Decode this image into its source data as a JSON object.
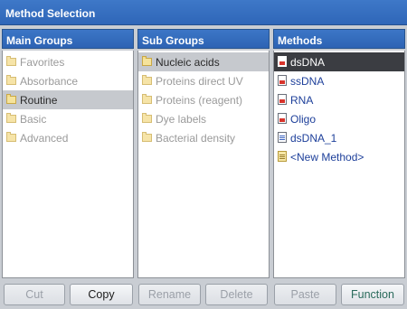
{
  "window": {
    "title": "Method Selection"
  },
  "main_groups": {
    "header": "Main Groups",
    "items": [
      {
        "label": "Favorites",
        "state": "disabled",
        "icon": "folder-icon"
      },
      {
        "label": "Absorbance",
        "state": "disabled",
        "icon": "folder-icon"
      },
      {
        "label": "Routine",
        "state": "selected",
        "icon": "folder-open-icon"
      },
      {
        "label": "Basic",
        "state": "disabled",
        "icon": "folder-icon"
      },
      {
        "label": "Advanced",
        "state": "disabled",
        "icon": "folder-icon"
      }
    ]
  },
  "sub_groups": {
    "header": "Sub Groups",
    "items": [
      {
        "label": "Nucleic acids",
        "state": "selected",
        "icon": "folder-open-icon"
      },
      {
        "label": "Proteins direct UV",
        "state": "disabled",
        "icon": "folder-icon"
      },
      {
        "label": "Proteins (reagent)",
        "state": "disabled",
        "icon": "folder-icon"
      },
      {
        "label": "Dye labels",
        "state": "disabled",
        "icon": "folder-icon"
      },
      {
        "label": "Bacterial density",
        "state": "disabled",
        "icon": "folder-icon"
      }
    ]
  },
  "methods": {
    "header": "Methods",
    "items": [
      {
        "label": "dsDNA",
        "state": "selected",
        "icon": "locked-method-icon"
      },
      {
        "label": "ssDNA",
        "state": "normal",
        "icon": "locked-method-icon"
      },
      {
        "label": "RNA",
        "state": "normal",
        "icon": "locked-method-icon"
      },
      {
        "label": "Oligo",
        "state": "normal",
        "icon": "locked-method-icon"
      },
      {
        "label": "dsDNA_1",
        "state": "normal",
        "icon": "user-method-icon"
      },
      {
        "label": "<New Method>",
        "state": "normal",
        "icon": "new-method-icon"
      }
    ]
  },
  "buttons": {
    "cut": "Cut",
    "copy": "Copy",
    "rename": "Rename",
    "delete": "Delete",
    "paste": "Paste",
    "function": "Function"
  },
  "colors": {
    "header_blue": "#2f66b8",
    "selection_dark": "#3b3d42",
    "selection_gray": "#c6c9ce",
    "disabled_text": "#9a9a9a",
    "method_text": "#1d3f9a"
  }
}
